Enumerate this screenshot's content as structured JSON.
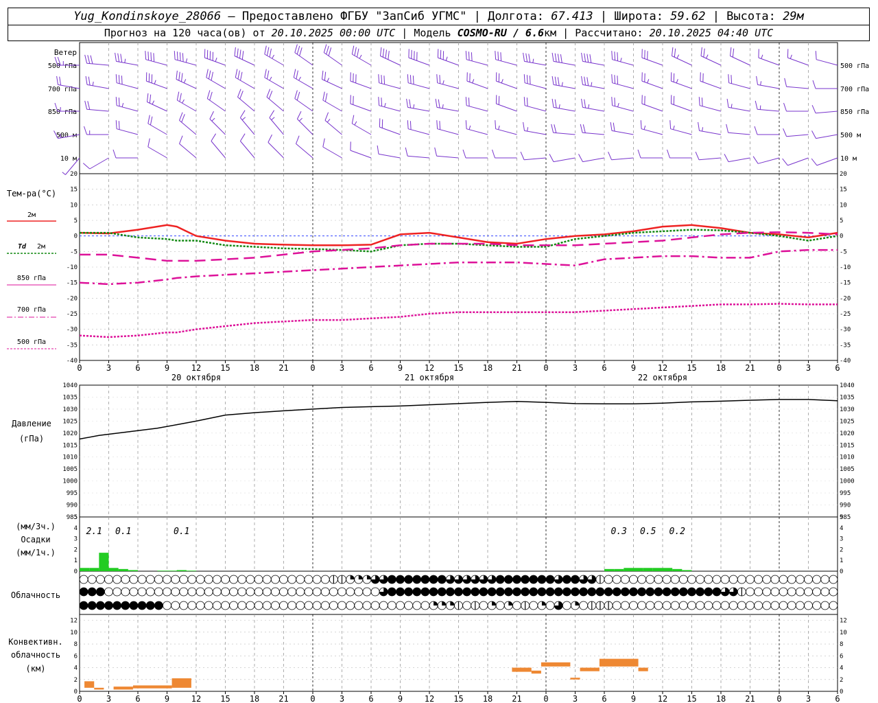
{
  "header": {
    "station": "Yug_Kondinskoye_28066",
    "sep1": " – ",
    "provided": "Предоставлено ФГБУ \"ЗапСиб УГМС\"",
    "lon_label": "Долгота:",
    "lon": "67.413",
    "lat_label": "Широта:",
    "lat": "59.62",
    "alt_label": "Высота:",
    "alt": "29м",
    "forecast_prefix": "Прогноз на 120 часа(ов) от",
    "forecast_start": "20.10.2025 00:00 UTC",
    "model_label": "Модель",
    "model": "COSMO-RU / 6.6",
    "model_unit": "км",
    "calc_label": "Рассчитано:",
    "calc_time": "20.10.2025 04:40 UTC"
  },
  "labels": {
    "wind": "Ветер",
    "wind_levels": [
      "500 гПа",
      "700 гПа",
      "850 гПа",
      "500 м",
      "10  м"
    ],
    "temp_title": "Тем-ра(°C)",
    "temp_2m": "2м",
    "td": "Td",
    "td_2m": "2м",
    "t850": "850 гПа",
    "t700": "700 гПа",
    "t500": "500 гПа",
    "pressure_1": "Давление",
    "pressure_2": "(гПа)",
    "precip_1": "(мм/3ч.)",
    "precip_2": "Осадки",
    "precip_3": "(мм/1ч.)",
    "cloud": "Облачность",
    "conv_1": "Конвективн.",
    "conv_2": "облачность",
    "conv_3": "(км)"
  },
  "colors": {
    "wind": "#7733cc",
    "t2m": "#ee2222",
    "td": "#118811",
    "levels": "#dd1199",
    "precip": "#22cc22",
    "conv": "#ee8833"
  },
  "chart_data": {
    "type": "line",
    "time_ticks": [
      "0",
      "3",
      "6",
      "9",
      "12",
      "15",
      "18",
      "21",
      "0",
      "3",
      "6",
      "9",
      "12",
      "15",
      "18",
      "21",
      "0",
      "3",
      "6",
      "9",
      "12",
      "15",
      "18",
      "21",
      "0",
      "3",
      "6"
    ],
    "days": [
      "20 октября",
      "21 октября",
      "22 октября"
    ],
    "temperature": {
      "ylim": [
        -40,
        20
      ],
      "yticks": [
        20,
        15,
        10,
        5,
        0,
        -5,
        -10,
        -15,
        -20,
        -25,
        -30,
        -35,
        -40
      ],
      "x": [
        0,
        3,
        6,
        9,
        10,
        12,
        15,
        18,
        21,
        24,
        27,
        30,
        33,
        36,
        39,
        42,
        45,
        48,
        51,
        54,
        57,
        60,
        63,
        66,
        69,
        72,
        75,
        78
      ],
      "series": [
        {
          "name": "2м",
          "values": [
            1,
            0.8,
            2,
            3.5,
            3,
            0,
            -1.5,
            -2.5,
            -2.8,
            -3,
            -3,
            -2.8,
            0.5,
            1,
            -0.5,
            -2,
            -2.5,
            -1,
            0,
            0.5,
            1.5,
            3,
            3.5,
            2.5,
            1,
            0.5,
            -0.5,
            1
          ]
        },
        {
          "name": "Td 2м",
          "values": [
            1,
            1,
            -0.5,
            -1,
            -1.5,
            -1.5,
            -3,
            -3.5,
            -4,
            -4.2,
            -4.5,
            -5,
            -3,
            -2.5,
            -2.5,
            -3,
            -3.5,
            -3.5,
            -1,
            0,
            1,
            1.5,
            2,
            1.8,
            1,
            0,
            -1.5,
            0
          ]
        },
        {
          "name": "850 гПа",
          "values": [
            -6,
            -6,
            -7,
            -8,
            -8,
            -8,
            -7.5,
            -7,
            -6,
            -5,
            -4.5,
            -4,
            -3,
            -2.5,
            -2.5,
            -2.5,
            -3,
            -3,
            -3,
            -2.5,
            -2,
            -1.5,
            -0.5,
            0.5,
            1,
            1.2,
            1,
            0.5
          ]
        },
        {
          "name": "700 гПа",
          "values": [
            -15,
            -15.5,
            -15,
            -14,
            -13.5,
            -13,
            -12.5,
            -12,
            -11.5,
            -11,
            -10.5,
            -10,
            -9.5,
            -9,
            -8.5,
            -8.5,
            -8.5,
            -9,
            -9.5,
            -7.5,
            -7,
            -6.5,
            -6.5,
            -7,
            -7,
            -5,
            -4.5,
            -4.5
          ]
        },
        {
          "name": "500 гПа",
          "values": [
            -32,
            -32.5,
            -32,
            -31,
            -31,
            -30,
            -29,
            -28,
            -27.5,
            -27,
            -27,
            -26.5,
            -26,
            -25,
            -24.5,
            -24.5,
            -24.5,
            -24.5,
            -24.5,
            -24,
            -23.5,
            -23,
            -22.5,
            -22,
            -22,
            -21.8,
            -22,
            -22
          ]
        }
      ]
    },
    "pressure": {
      "ylim": [
        985,
        1040
      ],
      "yticks": [
        1040,
        1035,
        1030,
        1025,
        1020,
        1015,
        1010,
        1005,
        1000,
        995,
        990,
        985
      ],
      "x": [
        0,
        2,
        4,
        6,
        8,
        10,
        12,
        15,
        18,
        21,
        24,
        27,
        30,
        33,
        36,
        39,
        42,
        45,
        48,
        51,
        54,
        57,
        60,
        63,
        66,
        69,
        72,
        75,
        78
      ],
      "values": [
        1017.5,
        1019,
        1020,
        1021,
        1022,
        1023.5,
        1025,
        1027.5,
        1028.5,
        1029.3,
        1030,
        1030.7,
        1031,
        1031.3,
        1031.8,
        1032.3,
        1032.8,
        1033.2,
        1032.8,
        1032.3,
        1032.2,
        1032.2,
        1032.5,
        1033,
        1033.3,
        1033.7,
        1034,
        1034,
        1033.5
      ]
    },
    "precip": {
      "ylim": [
        0,
        5
      ],
      "yticks": [
        5,
        4,
        3,
        2,
        1,
        0
      ],
      "hourly": [
        {
          "t": 0,
          "v": 0.3
        },
        {
          "t": 1,
          "v": 0.3
        },
        {
          "t": 2,
          "v": 1.7
        },
        {
          "t": 3,
          "v": 0.3
        },
        {
          "t": 4,
          "v": 0.2
        },
        {
          "t": 5,
          "v": 0.1
        },
        {
          "t": 8,
          "v": 0.05
        },
        {
          "t": 9,
          "v": 0.05
        },
        {
          "t": 10,
          "v": 0.1
        },
        {
          "t": 11,
          "v": 0.05
        },
        {
          "t": 54,
          "v": 0.2
        },
        {
          "t": 55,
          "v": 0.2
        },
        {
          "t": 56,
          "v": 0.3
        },
        {
          "t": 57,
          "v": 0.3
        },
        {
          "t": 58,
          "v": 0.3
        },
        {
          "t": 59,
          "v": 0.3
        },
        {
          "t": 60,
          "v": 0.3
        },
        {
          "t": 61,
          "v": 0.2
        },
        {
          "t": 62,
          "v": 0.1
        }
      ],
      "labels3h": [
        {
          "t": 1.5,
          "text": "2.1"
        },
        {
          "t": 4.5,
          "text": "0.1"
        },
        {
          "t": 10.5,
          "text": "0.1"
        },
        {
          "t": 55.5,
          "text": "0.3"
        },
        {
          "t": 58.5,
          "text": "0.5"
        },
        {
          "t": 61.5,
          "text": "0.2"
        }
      ]
    },
    "cloud": {
      "rows": [
        "0000000000000000000000000000001122233444444433333344444443443310000000000000000000000000000",
        "4440000000000000000000000000000000003444444444444444444444444444444444444444433100000000000",
        "4444444444000000000000000000000000000000002221010202010203020111000000000000000000000000000"
      ]
    },
    "convective": {
      "ylim": [
        0,
        13
      ],
      "yticks": [
        12,
        10,
        8,
        6,
        4,
        2,
        0
      ],
      "bars": [
        {
          "t0": 0.5,
          "t1": 1.5,
          "lo": 0.6,
          "hi": 1.7
        },
        {
          "t0": 1.5,
          "t1": 2.5,
          "lo": 0.3,
          "hi": 0.6
        },
        {
          "t0": 3.5,
          "t1": 5.5,
          "lo": 0.3,
          "hi": 0.8
        },
        {
          "t0": 5.5,
          "t1": 9.5,
          "lo": 0.5,
          "hi": 1.0
        },
        {
          "t0": 9.5,
          "t1": 11.5,
          "lo": 0.6,
          "hi": 2.2
        },
        {
          "t0": 44.5,
          "t1": 46.5,
          "lo": 3.3,
          "hi": 4.0
        },
        {
          "t0": 46.5,
          "t1": 47.5,
          "lo": 3.0,
          "hi": 3.5
        },
        {
          "t0": 47.5,
          "t1": 50.5,
          "lo": 4.2,
          "hi": 4.9
        },
        {
          "t0": 50.5,
          "t1": 51.5,
          "lo": 2.0,
          "hi": 2.3
        },
        {
          "t0": 51.5,
          "t1": 53.5,
          "lo": 3.4,
          "hi": 4.0
        },
        {
          "t0": 53.5,
          "t1": 57.5,
          "lo": 4.2,
          "hi": 5.5
        },
        {
          "t0": 57.5,
          "t1": 58.5,
          "lo": 3.4,
          "hi": 4.0
        }
      ]
    },
    "wind": {
      "levels": [
        {
          "name": "500 гПа",
          "dirs": [
            270,
            275,
            280,
            285,
            285,
            290,
            295,
            300,
            305,
            305,
            300,
            295,
            290,
            290,
            285,
            285,
            280,
            280,
            280,
            285,
            290,
            295,
            295,
            295,
            290,
            290,
            285
          ],
          "speeds": [
            25,
            30,
            35,
            40,
            45,
            45,
            40,
            35,
            30,
            30,
            35,
            40,
            40,
            35,
            30,
            30,
            35,
            40,
            40,
            35,
            30,
            25,
            25,
            20,
            15,
            15,
            10
          ]
        },
        {
          "name": "700 гПа",
          "dirs": [
            280,
            280,
            285,
            290,
            295,
            300,
            300,
            300,
            300,
            295,
            290,
            285,
            285,
            285,
            290,
            290,
            285,
            280,
            280,
            285,
            290,
            290,
            290,
            285,
            280,
            275,
            270
          ],
          "speeds": [
            20,
            25,
            30,
            35,
            35,
            30,
            30,
            25,
            25,
            25,
            30,
            30,
            30,
            25,
            25,
            25,
            30,
            35,
            35,
            30,
            25,
            25,
            20,
            20,
            15,
            10,
            10
          ]
        },
        {
          "name": "850 гПа",
          "dirs": [
            270,
            275,
            285,
            295,
            300,
            305,
            310,
            310,
            305,
            300,
            290,
            285,
            280,
            280,
            285,
            290,
            285,
            280,
            280,
            285,
            290,
            290,
            285,
            280,
            275,
            270,
            265
          ],
          "speeds": [
            15,
            20,
            25,
            25,
            25,
            20,
            20,
            20,
            20,
            20,
            20,
            25,
            25,
            25,
            20,
            20,
            20,
            25,
            25,
            25,
            20,
            20,
            20,
            15,
            15,
            10,
            10
          ]
        },
        {
          "name": "500 м",
          "dirs": [
            260,
            270,
            285,
            300,
            310,
            315,
            320,
            320,
            315,
            310,
            300,
            290,
            285,
            285,
            285,
            285,
            280,
            275,
            275,
            280,
            285,
            285,
            280,
            275,
            270,
            265,
            260
          ],
          "speeds": [
            15,
            15,
            20,
            20,
            20,
            15,
            15,
            15,
            15,
            15,
            15,
            20,
            20,
            20,
            15,
            15,
            15,
            20,
            20,
            20,
            15,
            15,
            15,
            10,
            10,
            10,
            10
          ]
        },
        {
          "name": "10  м",
          "dirs": [
            220,
            240,
            270,
            300,
            310,
            320,
            320,
            315,
            310,
            300,
            290,
            280,
            275,
            275,
            270,
            270,
            265,
            260,
            260,
            265,
            270,
            270,
            265,
            260,
            255,
            250,
            250
          ],
          "speeds": [
            5,
            10,
            10,
            10,
            10,
            10,
            10,
            10,
            10,
            10,
            10,
            10,
            10,
            10,
            10,
            10,
            10,
            10,
            10,
            10,
            10,
            10,
            10,
            10,
            10,
            10,
            10
          ]
        }
      ]
    }
  }
}
